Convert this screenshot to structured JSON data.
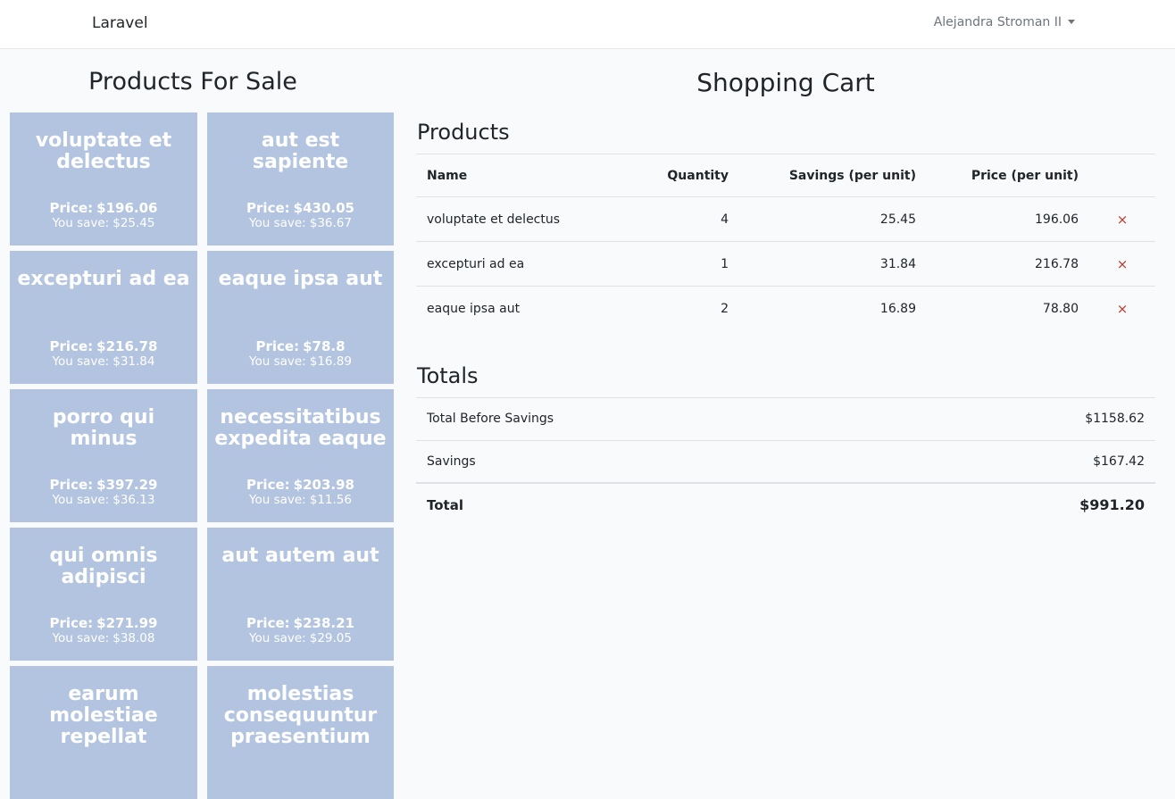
{
  "navbar": {
    "brand": "Laravel",
    "user_name": "Alejandra Stroman II"
  },
  "products_section": {
    "title": "Products For Sale",
    "price_label": "Price:",
    "save_label": "You save:",
    "items": [
      {
        "name": "voluptate et delectus",
        "price": "$196.06",
        "savings": "$25.45"
      },
      {
        "name": "aut est sapiente",
        "price": "$430.05",
        "savings": "$36.67"
      },
      {
        "name": "excepturi ad ea",
        "price": "$216.78",
        "savings": "$31.84"
      },
      {
        "name": "eaque ipsa aut",
        "price": "$78.8",
        "savings": "$16.89"
      },
      {
        "name": "porro qui minus",
        "price": "$397.29",
        "savings": "$36.13"
      },
      {
        "name": "necessitatibus expedita eaque",
        "price": "$203.98",
        "savings": "$11.56"
      },
      {
        "name": "qui omnis adipisci",
        "price": "$271.99",
        "savings": "$38.08"
      },
      {
        "name": "aut autem aut",
        "price": "$238.21",
        "savings": "$29.05"
      },
      {
        "name": "earum molestiae repellat",
        "price": "",
        "savings": ""
      },
      {
        "name": "molestias consequuntur praesentium",
        "price": "",
        "savings": ""
      }
    ]
  },
  "cart": {
    "title": "Shopping Cart",
    "products_heading": "Products",
    "columns": {
      "name": "Name",
      "quantity": "Quantity",
      "savings": "Savings (per unit)",
      "price": "Price (per unit)"
    },
    "remove_icon": "×",
    "rows": [
      {
        "name": "voluptate et delectus",
        "quantity": "4",
        "savings": "25.45",
        "price": "196.06"
      },
      {
        "name": "excepturi ad ea",
        "quantity": "1",
        "savings": "31.84",
        "price": "216.78"
      },
      {
        "name": "eaque ipsa aut",
        "quantity": "2",
        "savings": "16.89",
        "price": "78.80"
      }
    ],
    "totals_heading": "Totals",
    "totals": {
      "before_label": "Total Before Savings",
      "before_value": "$1158.62",
      "savings_label": "Savings",
      "savings_value": "$167.42",
      "total_label": "Total",
      "total_value": "$991.20"
    }
  },
  "colors": {
    "card_bg": "#b3c4e0",
    "remove": "#c0392b",
    "page_bg": "#f8fafc"
  }
}
